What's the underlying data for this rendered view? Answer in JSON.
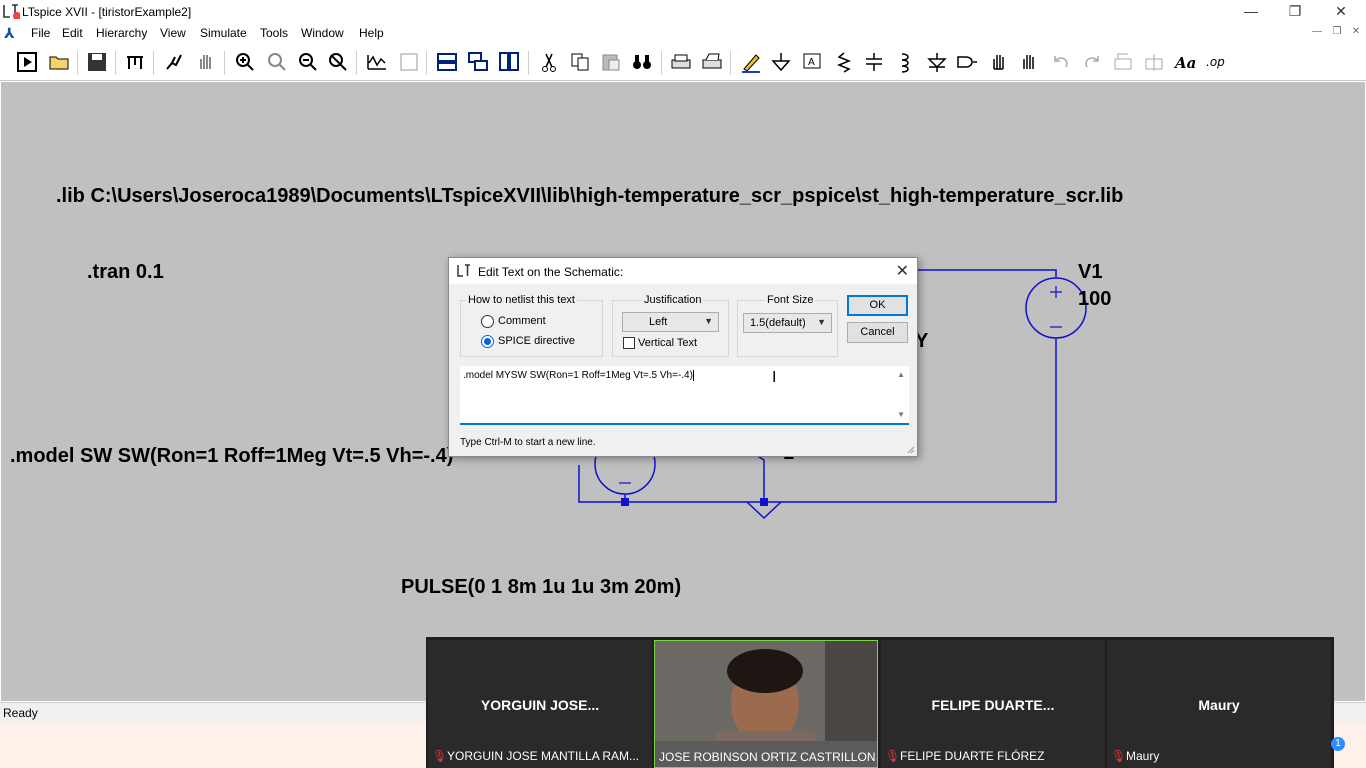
{
  "window": {
    "title": "LTspice XVII - [tiristorExample2]",
    "minimize": "—",
    "restore": "❐",
    "close": "✕"
  },
  "menu": {
    "items": [
      "File",
      "Edit",
      "Hierarchy",
      "View",
      "Simulate",
      "Tools",
      "Window",
      "Help"
    ]
  },
  "schematic": {
    "lib_directive": ".lib C:\\Users\\Joseroca1989\\Documents\\LTspiceXVII\\lib\\high-temperature_scr_pspice\\st_high-temperature_scr.lib",
    "tran_directive": ".tran 0.1",
    "model_directive": ".model SW SW(Ron=1 Roff=1Meg Vt=.5 Vh=-.4)",
    "pulse_label": "PULSE(0 1 8m 1u 1u 3m 20m)",
    "v1_name": "V1",
    "v1_value": "100",
    "partial_label_y": "Y",
    "partial_label_1": "1",
    "wire_color": "#1010d0"
  },
  "status": {
    "text": "Ready"
  },
  "dialog": {
    "title": "Edit Text on the Schematic:",
    "netlist_group": "How to netlist this text",
    "opt_comment": "Comment",
    "opt_spice": "SPICE directive",
    "justification_group": "Justification",
    "justification_value": "Left",
    "vertical_text": "Vertical Text",
    "font_size_group": "Font Size",
    "font_size_value": "1.5(default)",
    "ok": "OK",
    "cancel": "Cancel",
    "text_value": ".model MYSW SW(Ron=1 Roff=1Meg Vt=.5 Vh=-.4)",
    "hint": "Type Ctrl-M to start a new line."
  },
  "video": {
    "participants": [
      {
        "name": "YORGUIN JOSE...",
        "full": "YORGUIN JOSE MANTILLA RAM...",
        "muted": true
      },
      {
        "name": "",
        "full": "JOSE ROBINSON ORTIZ CASTRILLON",
        "muted": false
      },
      {
        "name": "FELIPE DUARTE...",
        "full": "FELIPE DUARTE FLÓREZ",
        "muted": true
      },
      {
        "name": "Maury",
        "full": "Maury",
        "muted": true
      }
    ],
    "badge": "1"
  }
}
